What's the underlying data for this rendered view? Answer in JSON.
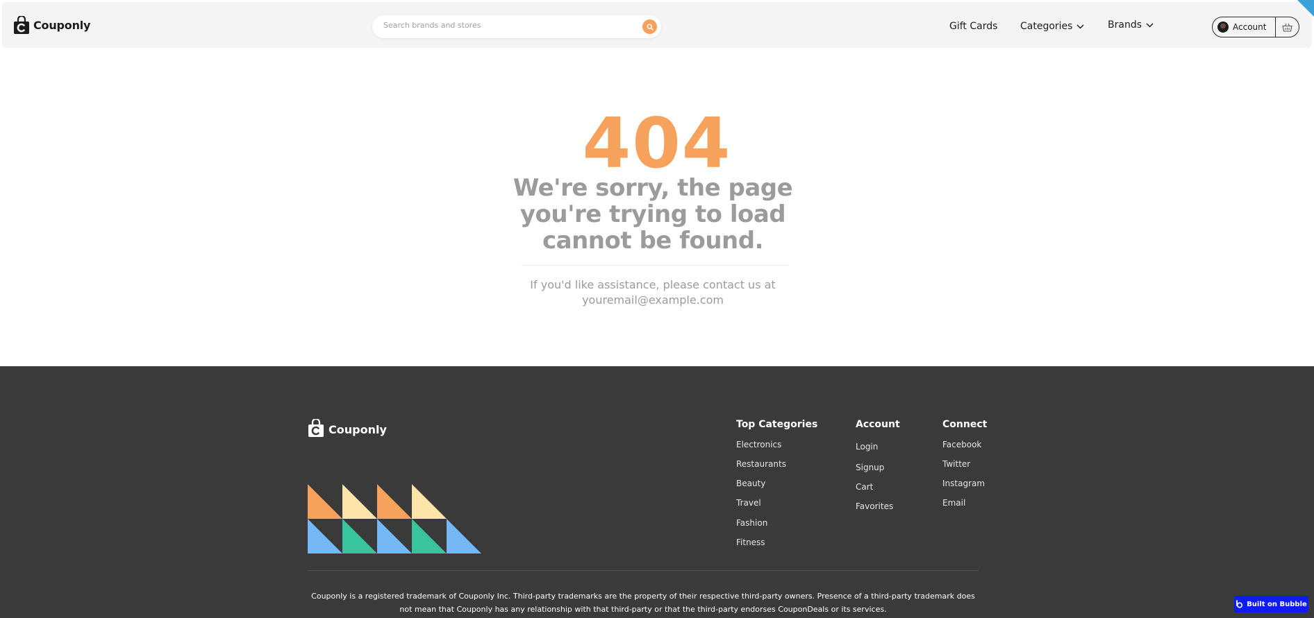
{
  "header": {
    "logo_text": "Couponly",
    "search_placeholder": "Search brands and stores",
    "nav": {
      "gift_cards": "Gift Cards",
      "categories": "Categories",
      "brands": "Brands"
    },
    "account_label": "Account"
  },
  "error": {
    "code": "404",
    "title": "We're sorry, the page you're trying to load cannot be found.",
    "help_line1": "If you'd like assistance, please contact us at",
    "help_line2": "youremail@example.com"
  },
  "footer": {
    "logo_text": "Couponly",
    "columns": [
      {
        "heading": "Top Categories",
        "links": [
          "Electronics",
          "Restaurants",
          "Beauty",
          "Travel",
          "Fashion",
          "Fitness"
        ]
      },
      {
        "heading": "Account",
        "links": [
          "Login",
          "Signup",
          "Cart",
          "Favorites"
        ]
      },
      {
        "heading": "Connect",
        "links": [
          "Facebook",
          "Twitter",
          "Instagram",
          "Email"
        ]
      }
    ],
    "legal": "Couponly is a registered trademark of Couponly Inc. Third-party trademarks are the property of their respective third-party owners. Presence of a third-party trademark does not mean that Couponly has any relationship with that third-party or that the third-party endorses CouponDeals or its services."
  },
  "badge": {
    "label": "Built on Bubble"
  },
  "colors": {
    "accent_orange": "#f6a25d",
    "cream": "#fde4a8",
    "blue": "#74b9f5",
    "green": "#38c49c",
    "footer_bg": "#3a3a3a",
    "bubble_blue": "#0d1cf0"
  }
}
